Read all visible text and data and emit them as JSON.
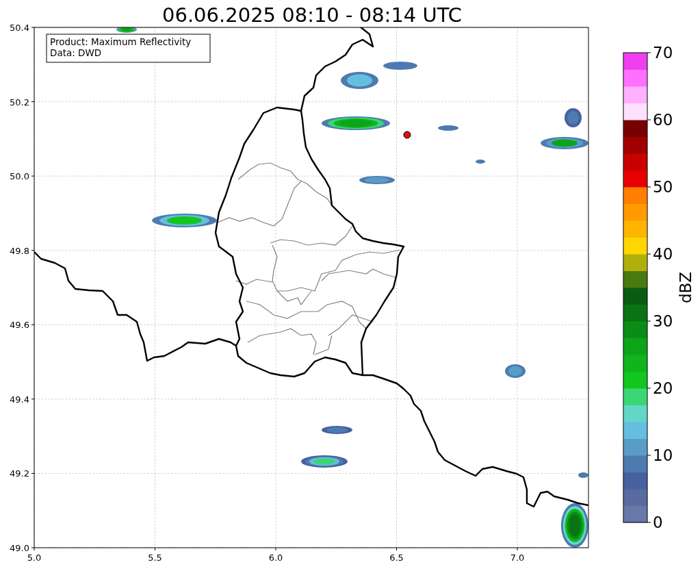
{
  "title": "06.06.2025 08:10 - 08:14 UTC",
  "info_box": [
    "Product: Maximum Reflectivity",
    "Data: DWD"
  ],
  "map": {
    "xticks": [
      "5.0",
      "5.5",
      "6.0",
      "6.5",
      "7.0"
    ],
    "yticks": [
      "50.4",
      "50.2",
      "50.0",
      "49.8",
      "49.6",
      "49.4",
      "49.2",
      "49.0"
    ]
  },
  "colorbar": {
    "label": "dBZ",
    "ticks": [
      "70",
      "60",
      "50",
      "40",
      "30",
      "20",
      "10",
      "0"
    ],
    "bins": [
      {
        "color": "#6878a8"
      },
      {
        "color": "#596aa0"
      },
      {
        "color": "#4860a0"
      },
      {
        "color": "#4d7ab0"
      },
      {
        "color": "#5a9cc8"
      },
      {
        "color": "#66bede"
      },
      {
        "color": "#63d6c8"
      },
      {
        "color": "#3dd676"
      },
      {
        "color": "#13c61f"
      },
      {
        "color": "#10b41d"
      },
      {
        "color": "#0ea41a"
      },
      {
        "color": "#0b8c17"
      },
      {
        "color": "#0a7415"
      },
      {
        "color": "#0a5c12"
      },
      {
        "color": "#4a7a0f"
      },
      {
        "color": "#b0b00a"
      },
      {
        "color": "#ffd600"
      },
      {
        "color": "#ffb400"
      },
      {
        "color": "#ff9a00"
      },
      {
        "color": "#ff7f00"
      },
      {
        "color": "#e80000"
      },
      {
        "color": "#c80000"
      },
      {
        "color": "#a00000"
      },
      {
        "color": "#780000"
      },
      {
        "color": "#ffe0ff"
      },
      {
        "color": "#ffb0ff"
      },
      {
        "color": "#ff70ff"
      },
      {
        "color": "#ee40ee"
      }
    ]
  }
}
